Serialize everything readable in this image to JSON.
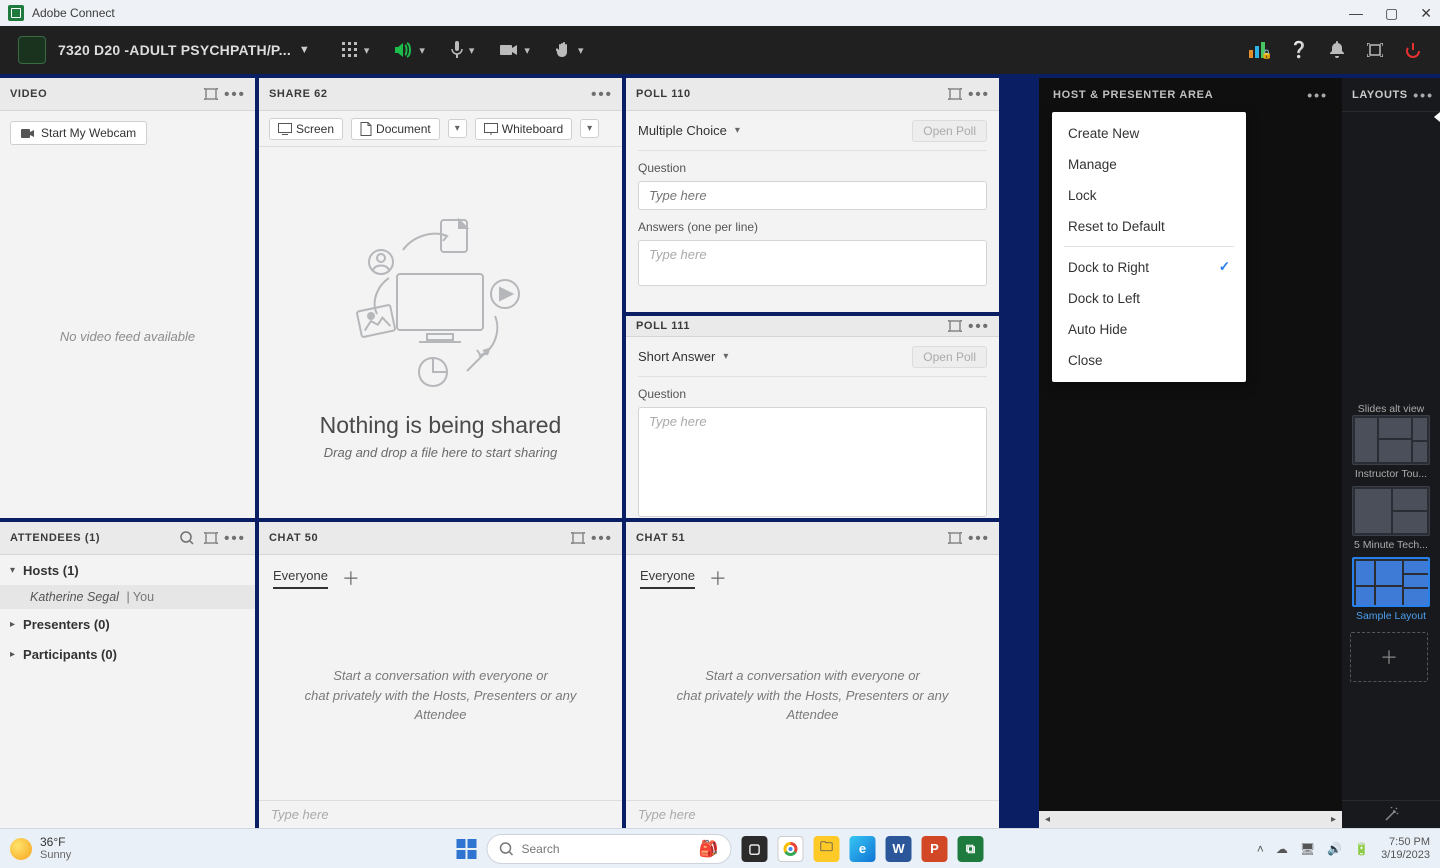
{
  "window": {
    "app_name": "Adobe Connect"
  },
  "toolbar": {
    "title": "7320 D20 -ADULT PSYCHPATH/P..."
  },
  "pods": {
    "video": {
      "title": "VIDEO",
      "webcam_btn": "Start My Webcam",
      "empty": "No video feed available"
    },
    "share": {
      "title": "SHARE 62",
      "screen": "Screen",
      "document": "Document",
      "whiteboard": "Whiteboard",
      "heading": "Nothing is being shared",
      "sub": "Drag and drop a file here to start sharing"
    },
    "poll1": {
      "title": "POLL 110",
      "type": "Multiple Choice",
      "open": "Open Poll",
      "q_label": "Question",
      "q_ph": "Type here",
      "a_label": "Answers (one per line)",
      "a_ph": "Type here"
    },
    "poll2": {
      "title": "POLL 111",
      "type": "Short Answer",
      "open": "Open Poll",
      "q_label": "Question",
      "q_ph": "Type here"
    },
    "attendees": {
      "title": "ATTENDEES  (1)",
      "hosts": "Hosts (1)",
      "user": "Katherine Segal",
      "you": "| You",
      "presenters": "Presenters (0)",
      "participants": "Participants (0)"
    },
    "chat1": {
      "title": "CHAT 50",
      "tab": "Everyone",
      "empty": "Start a conversation with everyone or\nchat privately with the Hosts, Presenters or any Attendee",
      "ph": "Type here"
    },
    "chat2": {
      "title": "CHAT 51",
      "tab": "Everyone",
      "empty": "Start a conversation with everyone or\nchat privately with the Hosts, Presenters or any Attendee",
      "ph": "Type here"
    }
  },
  "hp": {
    "title": "HOST & PRESENTER AREA"
  },
  "layouts": {
    "title": "LAYOUTS",
    "menu": [
      "Create New",
      "Manage",
      "Lock",
      "Reset to Default",
      "Dock to Right",
      "Dock to Left",
      "Auto Hide",
      "Close"
    ],
    "menu_checked": "Dock to Right",
    "items": [
      "Slides alt view",
      "Instructor Tou...",
      "5 Minute Tech...",
      "Sample Layout"
    ],
    "selected": "Sample Layout"
  },
  "taskbar": {
    "temp": "36°F",
    "cond": "Sunny",
    "search": "Search",
    "time": "7:50 PM",
    "date": "3/19/2023"
  }
}
